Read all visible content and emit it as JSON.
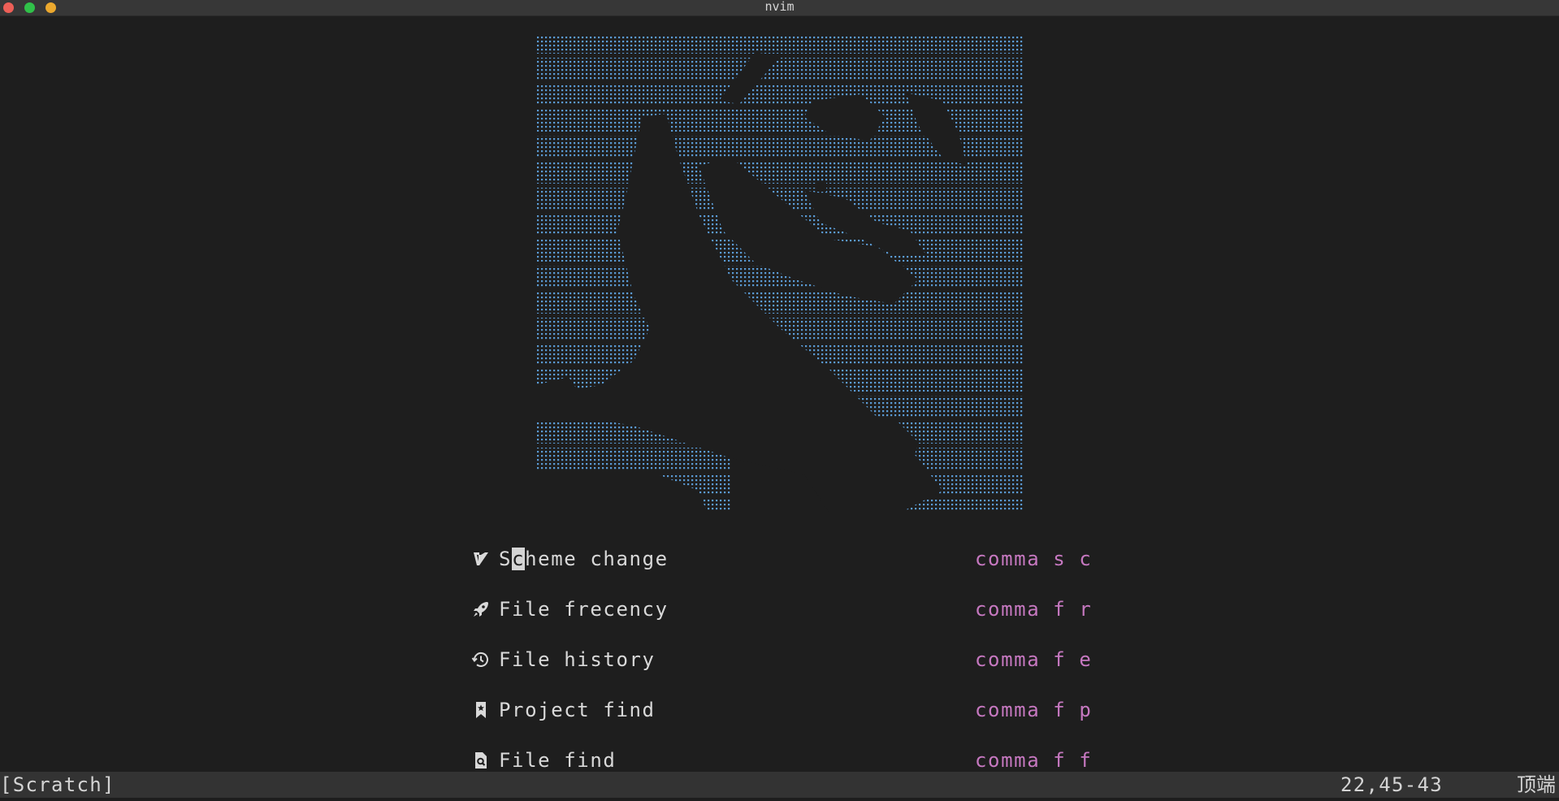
{
  "window": {
    "title": "nvim"
  },
  "colors": {
    "background": "#1e1e1e",
    "titlebar": "#373737",
    "ascii_art": "#5b9bd5",
    "menu_label": "#d9d9d9",
    "menu_key": "#c678c0",
    "statusline": "#333333"
  },
  "dashboard": {
    "ascii_art": "dotted image of a bird",
    "items": [
      {
        "icon": "vim-logo-icon",
        "label": "Scheme change",
        "label_first": "S",
        "label_cursor": "c",
        "label_rest": "heme change",
        "shortcut": "comma s c"
      },
      {
        "icon": "rocket-icon",
        "label": "File frecency",
        "shortcut": "comma f r"
      },
      {
        "icon": "history-icon",
        "label": "File history",
        "shortcut": "comma f e"
      },
      {
        "icon": "bookmark-icon",
        "label": "Project find",
        "shortcut": "comma f p"
      },
      {
        "icon": "file-search-icon",
        "label": "File find",
        "shortcut": "comma f f"
      }
    ]
  },
  "statusline": {
    "buffer": "[Scratch]",
    "position": "22,45-43",
    "scroll": "顶端"
  }
}
